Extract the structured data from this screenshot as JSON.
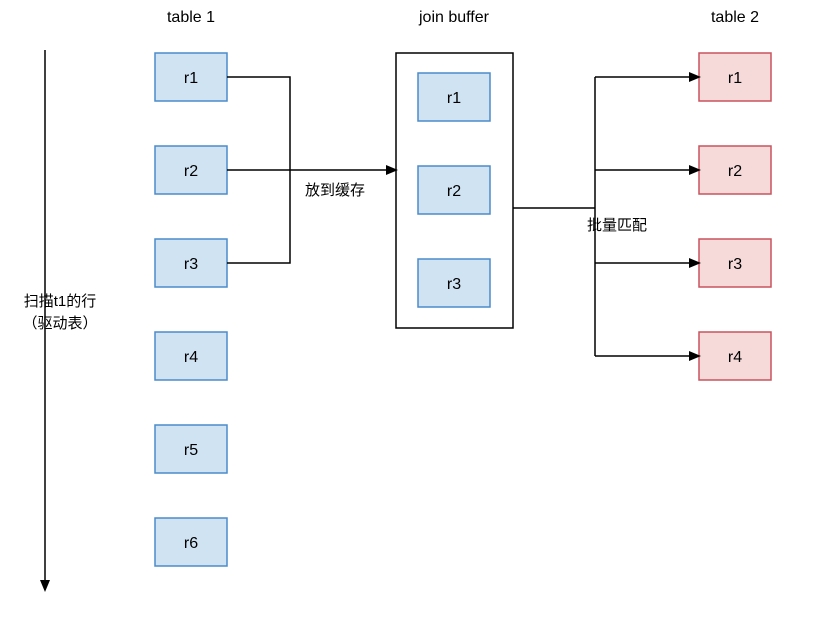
{
  "headers": {
    "table1": "table 1",
    "joinBuffer": "join buffer",
    "table2": "table 2"
  },
  "scanLabel": {
    "line1": "扫描t1的行",
    "line2": "（驱动表）"
  },
  "edgeLabels": {
    "toBuffer": "放到缓存",
    "toTable2": "批量匹配"
  },
  "table1Rows": [
    "r1",
    "r2",
    "r3",
    "r4",
    "r5",
    "r6"
  ],
  "bufferRows": [
    "r1",
    "r2",
    "r3"
  ],
  "table2Rows": [
    "r1",
    "r2",
    "r3",
    "r4"
  ]
}
